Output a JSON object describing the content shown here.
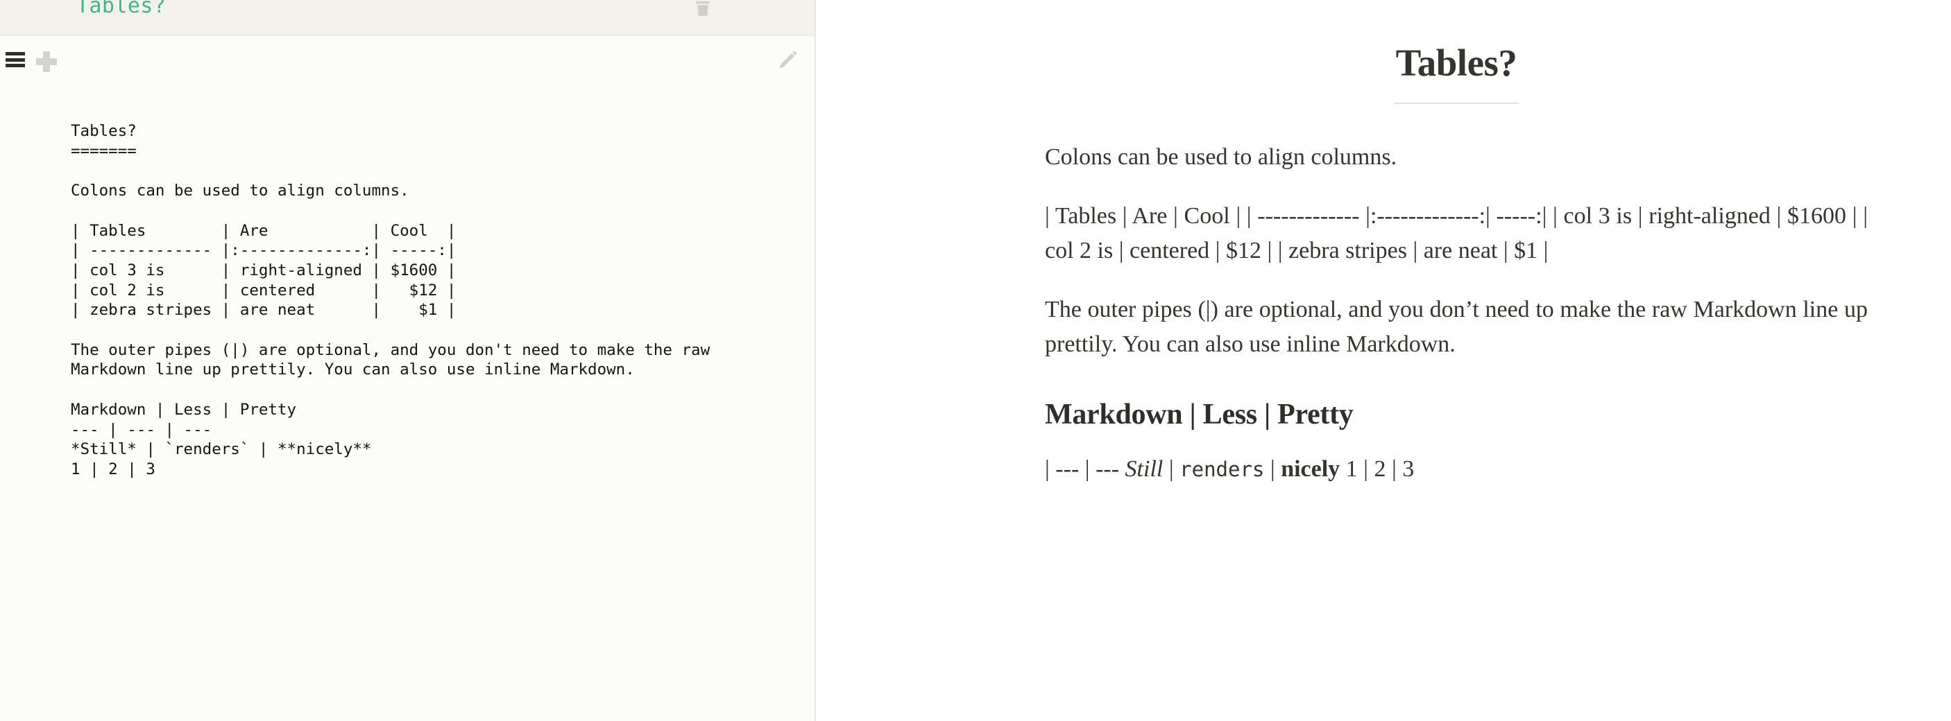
{
  "app": {
    "note_title": "Tables?",
    "accent_color": "#3fb684",
    "editor_bg": "#fcfcfa",
    "titlebar_bg": "#f2f1ec",
    "preview_bg": "#ffffff",
    "text_color": "#35352f"
  },
  "titlebar": {
    "title": "Tables?",
    "delete_icon": "trash-icon"
  },
  "toolbar": {
    "menu_icon": "hamburger-menu-icon",
    "new_note_icon": "plus-icon",
    "edit_icon": "pencil-icon"
  },
  "editor": {
    "source": "Tables?\n=======\n\nColons can be used to align columns.\n\n| Tables        | Are           | Cool  |\n| ------------- |:-------------:| -----:|\n| col 3 is      | right-aligned | $1600 |\n| col 2 is      | centered      |   $12 |\n| zebra stripes | are neat      |    $1 |\n\nThe outer pipes (|) are optional, and you don't need to make the raw\nMarkdown line up prettily. You can also use inline Markdown.\n\nMarkdown | Less | Pretty\n--- | --- | ---\n*Still* | `renders` | **nicely**\n1 | 2 | 3"
  },
  "preview": {
    "title": "Tables?",
    "paragraph_intro": "Colons can be used to align columns.",
    "paragraph_table": "| Tables | Are | Cool | | ------------- |:-------------:| -----:| | col 3 is | right-aligned | $1600 | | col 2 is | centered | $12 | | zebra stripes | are neat | $1 |",
    "paragraph_pipes": "The outer pipes (|) are optional, and you don’t need to make the raw Markdown line up prettily. You can also use inline Markdown.",
    "subheading": "Markdown | Less | Pretty",
    "final_line": {
      "prefix": "| --- | --- ",
      "italic": "Still",
      "sep1": " | ",
      "code": "renders",
      "sep2": " | ",
      "bold": "nicely",
      "suffix": " 1 | 2 | 3"
    }
  }
}
